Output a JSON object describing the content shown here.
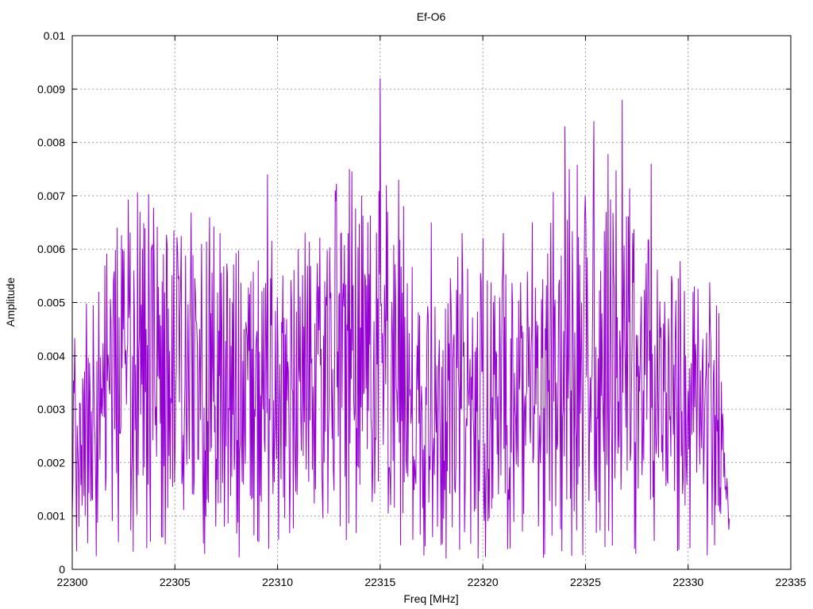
{
  "chart_data": {
    "type": "line",
    "title": "Ef-O6",
    "xlabel": "Freq [MHz]",
    "ylabel": "Amplitude",
    "xlim": [
      22300,
      22335
    ],
    "ylim": [
      0,
      0.01
    ],
    "x_ticks": [
      22300,
      22305,
      22310,
      22315,
      22320,
      22325,
      22330,
      22335
    ],
    "x_tick_labels": [
      "22300",
      "22305",
      "22310",
      "22315",
      "22320",
      "22325",
      "22330",
      "22335"
    ],
    "y_ticks": [
      0,
      0.001,
      0.002,
      0.003,
      0.004,
      0.005,
      0.006,
      0.007,
      0.008,
      0.009,
      0.01
    ],
    "y_tick_labels": [
      "0",
      "0.001",
      "0.002",
      "0.003",
      "0.004",
      "0.005",
      "0.006",
      "0.007",
      "0.008",
      "0.009",
      "0.01"
    ],
    "grid": true,
    "legend": "none",
    "series": [
      {
        "color": "#9400d3",
        "x_start": 22300.0,
        "x_step": 0.03,
        "peaks": [
          {
            "x": 22300.4,
            "y": 0.0031
          },
          {
            "x": 22301.2,
            "y": 0.0039
          },
          {
            "x": 22301.3,
            "y": 0.0052
          },
          {
            "x": 22302.0,
            "y": 0.0054
          },
          {
            "x": 22302.2,
            "y": 0.0064
          },
          {
            "x": 22303.0,
            "y": 0.0056
          },
          {
            "x": 22303.3,
            "y": 0.0067
          },
          {
            "x": 22304.0,
            "y": 0.0057
          },
          {
            "x": 22305.2,
            "y": 0.0055
          },
          {
            "x": 22306.3,
            "y": 0.0061
          },
          {
            "x": 22306.7,
            "y": 0.0066
          },
          {
            "x": 22307.2,
            "y": 0.0063
          },
          {
            "x": 22308.7,
            "y": 0.0054
          },
          {
            "x": 22309.5,
            "y": 0.0074
          },
          {
            "x": 22310.0,
            "y": 0.0051
          },
          {
            "x": 22311.0,
            "y": 0.006
          },
          {
            "x": 22312.0,
            "y": 0.0053
          },
          {
            "x": 22312.8,
            "y": 0.0071
          },
          {
            "x": 22313.1,
            "y": 0.0063
          },
          {
            "x": 22313.5,
            "y": 0.0075
          },
          {
            "x": 22315.0,
            "y": 0.0092
          },
          {
            "x": 22315.3,
            "y": 0.0072
          },
          {
            "x": 22315.9,
            "y": 0.0073
          },
          {
            "x": 22317.5,
            "y": 0.0065
          },
          {
            "x": 22319.0,
            "y": 0.0063
          },
          {
            "x": 22320.0,
            "y": 0.0062
          },
          {
            "x": 22321.0,
            "y": 0.0063
          },
          {
            "x": 22322.4,
            "y": 0.0065
          },
          {
            "x": 22324.0,
            "y": 0.0083
          },
          {
            "x": 22324.2,
            "y": 0.0075
          },
          {
            "x": 22325.0,
            "y": 0.007
          },
          {
            "x": 22325.4,
            "y": 0.0084
          },
          {
            "x": 22326.0,
            "y": 0.0067
          },
          {
            "x": 22326.8,
            "y": 0.0088
          },
          {
            "x": 22327.3,
            "y": 0.0063
          },
          {
            "x": 22328.2,
            "y": 0.0076
          },
          {
            "x": 22329.2,
            "y": 0.0055
          },
          {
            "x": 22330.3,
            "y": 0.0053
          },
          {
            "x": 22331.5,
            "y": 0.0048
          },
          {
            "x": 22331.8,
            "y": 0.0015
          }
        ],
        "envelope": [
          {
            "x": 22300.0,
            "y": 0.003
          },
          {
            "x": 22301.0,
            "y": 0.0035
          },
          {
            "x": 22302.0,
            "y": 0.0045
          },
          {
            "x": 22304.0,
            "y": 0.0045
          },
          {
            "x": 22307.0,
            "y": 0.0042
          },
          {
            "x": 22309.0,
            "y": 0.004
          },
          {
            "x": 22312.0,
            "y": 0.004
          },
          {
            "x": 22313.0,
            "y": 0.0048
          },
          {
            "x": 22315.0,
            "y": 0.005
          },
          {
            "x": 22317.0,
            "y": 0.0038
          },
          {
            "x": 22320.0,
            "y": 0.0038
          },
          {
            "x": 22323.0,
            "y": 0.004
          },
          {
            "x": 22324.0,
            "y": 0.005
          },
          {
            "x": 22327.0,
            "y": 0.005
          },
          {
            "x": 22329.0,
            "y": 0.004
          },
          {
            "x": 22331.0,
            "y": 0.0035
          },
          {
            "x": 22331.5,
            "y": 0.003
          },
          {
            "x": 22332.0,
            "y": 0.0007
          }
        ]
      }
    ]
  }
}
